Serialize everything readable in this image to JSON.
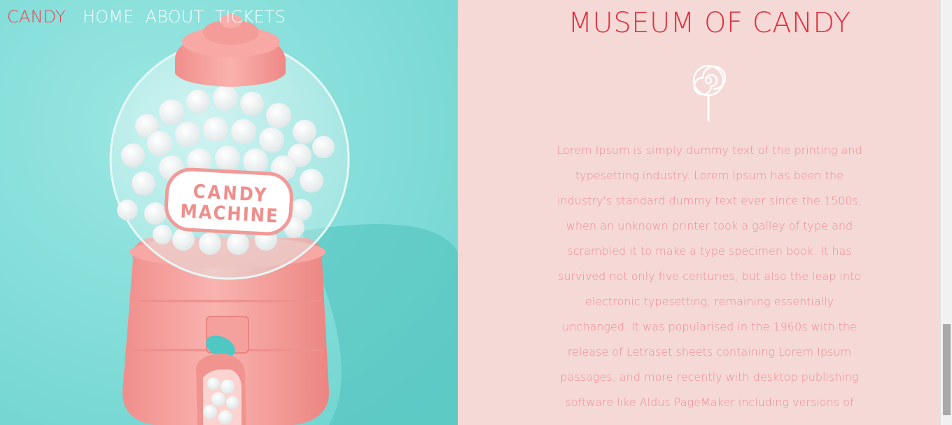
{
  "nav": {
    "brand": "CANDY",
    "links": [
      "HOME",
      "ABOUT",
      "TICKETS"
    ]
  },
  "hero": {
    "label_line1": "CANDY",
    "label_line2": "MACHINE"
  },
  "content": {
    "title": "MUSEUM OF CANDY",
    "body": "Lorem Ipsum is simply dummy text of the printing and typesetting industry. Lorem Ipsum has been the industry's standard dummy text ever since the 1500s, when an unknown printer took a galley of type and scrambled it to make a type specimen book. It has survived not only five centuries, but also the leap into electronic typesetting, remaining essentially unchanged. It was popularised in the 1960s with the release of Letraset sheets containing Lorem Ipsum passages, and more recently with desktop publishing software like Aldus PageMaker including versions of"
  },
  "icons": {
    "lollipop": "lollipop-icon"
  },
  "colors": {
    "brand": "#e24a55",
    "title": "#e0303f",
    "body_text": "#ef8a95",
    "panel_bg": "#f5d9d6",
    "hero_bg": "#86dcd8"
  }
}
